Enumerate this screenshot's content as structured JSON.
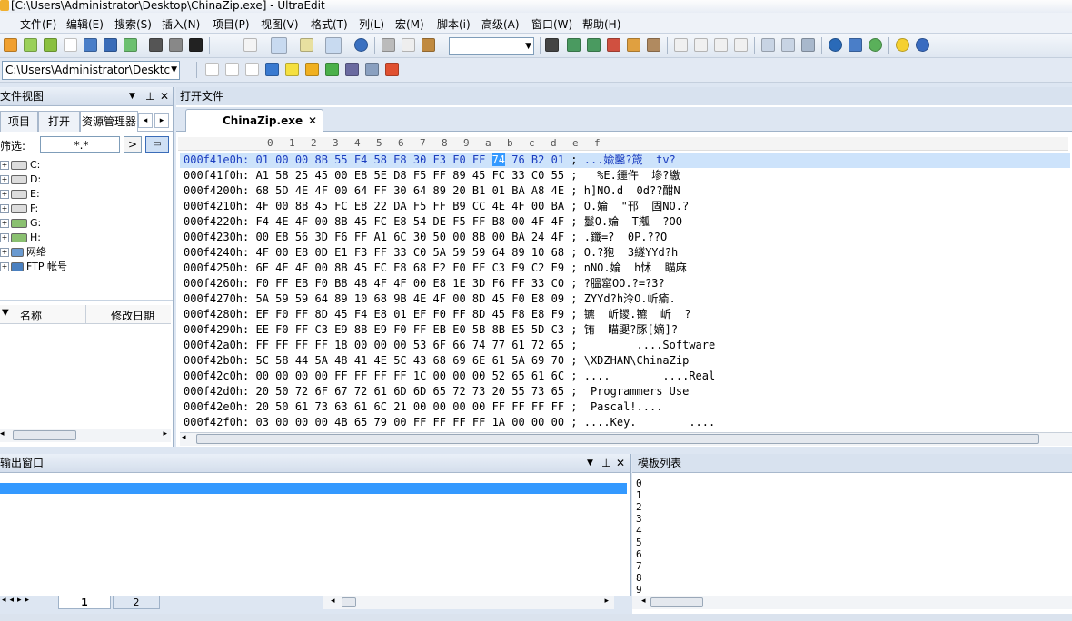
{
  "window": {
    "title": "[C:\\Users\\Administrator\\Desktop\\ChinaZip.exe] - UltraEdit"
  },
  "menu": [
    {
      "label": "文件(F)"
    },
    {
      "label": "编辑(E)"
    },
    {
      "label": "搜索(S)"
    },
    {
      "label": "插入(N)"
    },
    {
      "label": "项目(P)"
    },
    {
      "label": "视图(V)"
    },
    {
      "label": "格式(T)"
    },
    {
      "label": "列(L)"
    },
    {
      "label": "宏(M)"
    },
    {
      "label": "脚本(i)"
    },
    {
      "label": "高级(A)"
    },
    {
      "label": "窗口(W)"
    },
    {
      "label": "帮助(H)"
    }
  ],
  "toolbar2": {
    "path_value": "C:\\Users\\Administrator\\Desktc"
  },
  "left_panel": {
    "title": "文件视图",
    "tabs": [
      {
        "label": "项目"
      },
      {
        "label": "打开"
      },
      {
        "label": "资源管理器"
      }
    ],
    "filter_label": "筛选:",
    "filter_value": "*.*",
    "filter_go": ">",
    "tree": [
      {
        "label": "C:",
        "icon": "hard-drive-icon"
      },
      {
        "label": "D:",
        "icon": "hard-drive-icon"
      },
      {
        "label": "E:",
        "icon": "hard-drive-icon"
      },
      {
        "label": "F:",
        "icon": "hard-drive-icon"
      },
      {
        "label": "G:",
        "icon": "network-drive-icon"
      },
      {
        "label": "H:",
        "icon": "network-drive-icon"
      },
      {
        "label": "网络",
        "icon": "network-icon"
      },
      {
        "label": "FTP 帐号",
        "icon": "ftp-account-icon"
      }
    ],
    "list_columns": [
      {
        "label": "名称"
      },
      {
        "label": "修改日期"
      }
    ]
  },
  "editor": {
    "panel_title": "打开文件",
    "tab_label": "ChinaZip.exe",
    "hex_header": [
      "0",
      "1",
      "2",
      "3",
      "4",
      "5",
      "6",
      "7",
      "8",
      "9",
      "a",
      "b",
      "c",
      "d",
      "e",
      "f"
    ],
    "rows": [
      {
        "addr": "000f41e0h:",
        "hex": "01 00 00 8B 55 F4 58 E8 30 F3 F0 FF 74 76 B2 01",
        "ascii": "...婾鑿?箴  tv?"
      },
      {
        "addr": "000f41f0h:",
        "hex": "A1 58 25 45 00 E8 5E D8 F5 FF 89 45 FC 33 C0 55",
        "ascii": "  %E.鑩仵  墋?繳"
      },
      {
        "addr": "000f4200h:",
        "hex": "68 5D 4E 4F 00 64 FF 30 64 89 20 B1 01 BA A8 4E",
        "ascii": "h]NO.d  0d??酣N"
      },
      {
        "addr": "000f4210h:",
        "hex": "4F 00 8B 45 FC E8 22 DA F5 FF B9 CC 4E 4F 00 BA",
        "ascii": "O.婨  \"邗  固NO.?"
      },
      {
        "addr": "000f4220h:",
        "hex": "F4 4E 4F 00 8B 45 FC E8 54 DE F5 FF B8 00 4F 4F",
        "ascii": "鬘O.婨  T摦  ?OO"
      },
      {
        "addr": "000f4230h:",
        "hex": "00 E8 56 3D F6 FF A1 6C 30 50 00 8B 00 BA 24 4F",
        "ascii": ".鑯=?  0P.??O"
      },
      {
        "addr": "000f4240h:",
        "hex": "4F 00 E8 0D E1 F3 FF 33 C0 5A 59 59 64 89 10 68",
        "ascii": "O.?狍  3繸YYd?h"
      },
      {
        "addr": "000f4250h:",
        "hex": "6E 4E 4F 00 8B 45 FC E8 68 E2 F0 FF C3 E9 C2 E9",
        "ascii": "nNO.婨  h怵  瞄麻"
      },
      {
        "addr": "000f4260h:",
        "hex": "F0 FF EB F0 B8 48 4F 4F 00 E8 1E 3D F6 FF 33 C0",
        "ascii": "?膃窰OO.?=?3?"
      },
      {
        "addr": "000f4270h:",
        "hex": "5A 59 59 64 89 10 68 9B 4E 4F 00 8D 45 F0 E8 09",
        "ascii": "ZYYd?h泠O.岓瘉."
      },
      {
        "addr": "000f4280h:",
        "hex": "EF F0 FF 8D 45 F4 E8 01 EF F0 FF 8D 45 F8 E8 F9",
        "ascii": "镳  岓鑁.镳  岓  ?"
      },
      {
        "addr": "000f4290h:",
        "hex": "EE F0 FF C3 E9 8B E9 F0 FF EB E0 5B 8B E5 5D C3",
        "ascii": "铕  瞄夓?豚[嫡]?"
      },
      {
        "addr": "000f42a0h:",
        "hex": "FF FF FF FF 18 00 00 00 53 6F 66 74 77 61 72 65",
        "ascii": "        ....Software"
      },
      {
        "addr": "000f42b0h:",
        "hex": "5C 58 44 5A 48 41 4E 5C 43 68 69 6E 61 5A 69 70",
        "ascii": "\\XDZHAN\\ChinaZip"
      },
      {
        "addr": "000f42c0h:",
        "hex": "00 00 00 00 FF FF FF FF 1C 00 00 00 52 65 61 6C",
        "ascii": "....        ....Real"
      },
      {
        "addr": "000f42d0h:",
        "hex": "20 50 72 6F 67 72 61 6D 6D 65 72 73 20 55 73 65",
        "ascii": " Programmers Use"
      },
      {
        "addr": "000f42e0h:",
        "hex": "20 50 61 73 63 61 6C 21 00 00 00 00 FF FF FF FF",
        "ascii": " Pascal!...."
      },
      {
        "addr": "000f42f0h:",
        "hex": "03 00 00 00 4B 65 79 00 FF FF FF FF 1A 00 00 00",
        "ascii": "....Key.        ...."
      }
    ]
  },
  "output": {
    "title": "输出窗口"
  },
  "bottom_tabs": [
    {
      "label": "1"
    },
    {
      "label": "2"
    }
  ],
  "template": {
    "title": "模板列表",
    "items": [
      "0",
      "1",
      "2",
      "3",
      "4",
      "5",
      "6",
      "7",
      "8",
      "9"
    ]
  }
}
